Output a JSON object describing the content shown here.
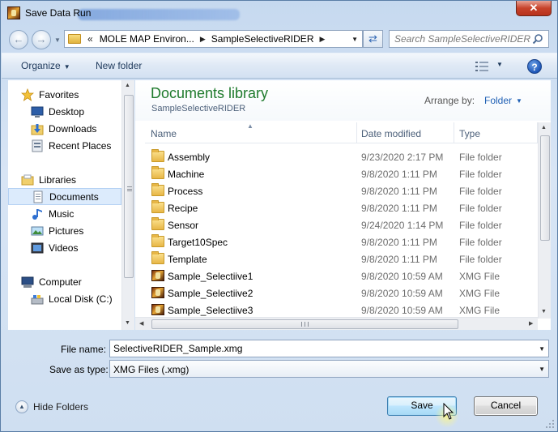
{
  "window": {
    "title": "Save Data Run",
    "close_label": "✕"
  },
  "address": {
    "overflow": "«",
    "segments": [
      "MOLE MAP Environ...",
      "SampleSelectiveRIDER"
    ],
    "search_placeholder": "Search SampleSelectiveRIDER"
  },
  "toolbar": {
    "organize": "Organize",
    "new_folder": "New folder"
  },
  "sidebar": {
    "items": [
      {
        "label": "Favorites",
        "icon": "star-icon"
      },
      {
        "label": "Desktop",
        "icon": "desktop-icon"
      },
      {
        "label": "Downloads",
        "icon": "downloads-icon"
      },
      {
        "label": "Recent Places",
        "icon": "recent-places-icon"
      },
      {
        "label": "Libraries",
        "icon": "libraries-icon"
      },
      {
        "label": "Documents",
        "icon": "documents-icon",
        "selected": true
      },
      {
        "label": "Music",
        "icon": "music-icon"
      },
      {
        "label": "Pictures",
        "icon": "pictures-icon"
      },
      {
        "label": "Videos",
        "icon": "videos-icon"
      },
      {
        "label": "Computer",
        "icon": "computer-icon"
      },
      {
        "label": "Local Disk (C:)",
        "icon": "local-disk-icon"
      }
    ]
  },
  "library": {
    "title": "Documents library",
    "subtitle": "SampleSelectiveRIDER",
    "arrange_label": "Arrange by:",
    "arrange_value": "Folder"
  },
  "columns": {
    "name": "Name",
    "date": "Date modified",
    "type": "Type"
  },
  "files": [
    {
      "name": "Assembly",
      "date": "9/23/2020 2:17 PM",
      "type": "File folder",
      "icon": "folder-icon"
    },
    {
      "name": "Machine",
      "date": "9/8/2020 1:11 PM",
      "type": "File folder",
      "icon": "folder-icon"
    },
    {
      "name": "Process",
      "date": "9/8/2020 1:11 PM",
      "type": "File folder",
      "icon": "folder-icon"
    },
    {
      "name": "Recipe",
      "date": "9/8/2020 1:11 PM",
      "type": "File folder",
      "icon": "folder-icon"
    },
    {
      "name": "Sensor",
      "date": "9/24/2020 1:14 PM",
      "type": "File folder",
      "icon": "folder-icon"
    },
    {
      "name": "Target10Spec",
      "date": "9/8/2020 1:11 PM",
      "type": "File folder",
      "icon": "folder-icon"
    },
    {
      "name": "Template",
      "date": "9/8/2020 1:11 PM",
      "type": "File folder",
      "icon": "folder-icon"
    },
    {
      "name": "Sample_Selectiive1",
      "date": "9/8/2020 10:59 AM",
      "type": "XMG File",
      "icon": "xmg-file-icon"
    },
    {
      "name": "Sample_Selectiive2",
      "date": "9/8/2020 10:59 AM",
      "type": "XMG File",
      "icon": "xmg-file-icon"
    },
    {
      "name": "Sample_Selectiive3",
      "date": "9/8/2020 10:59 AM",
      "type": "XMG File",
      "icon": "xmg-file-icon"
    }
  ],
  "save": {
    "file_name_label": "File name:",
    "file_name_value": "SelectiveRIDER_Sample.xmg",
    "type_label": "Save as type:",
    "type_value": "XMG Files (.xmg)",
    "hide_folders": "Hide Folders",
    "save_button": "Save",
    "cancel_button": "Cancel"
  },
  "colors": {
    "library_title": "#1e7a2c",
    "link_blue": "#1e5fb4",
    "selection": "#dcebfc"
  }
}
